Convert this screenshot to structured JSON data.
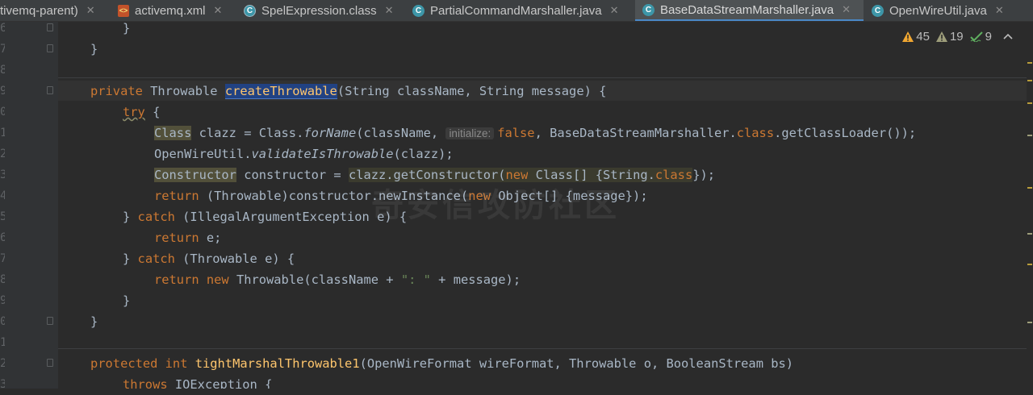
{
  "tabs": [
    {
      "label": "tivemq-parent)",
      "icon": "none",
      "active": false
    },
    {
      "label": "activemq.xml",
      "icon": "xml-file-icon",
      "active": false
    },
    {
      "label": "SpelExpression.class",
      "icon": "class-file-icon",
      "active": false
    },
    {
      "label": "PartialCommandMarshaller.java",
      "icon": "java-class-icon",
      "active": false
    },
    {
      "label": "BaseDataStreamMarshaller.java",
      "icon": "java-class-icon",
      "active": true
    },
    {
      "label": "OpenWireUtil.java",
      "icon": "java-class-icon",
      "active": false
    }
  ],
  "inspections": {
    "warnings": "45",
    "weak_warnings": "19",
    "typos": "9"
  },
  "line_numbers": [
    "6",
    "7",
    "8",
    "9",
    "0",
    "1",
    "2",
    "3",
    "4",
    "5",
    "6",
    "7",
    "8",
    "9",
    "0",
    "1",
    "2",
    "3"
  ],
  "code": {
    "l0": "}",
    "l1": "}",
    "l3": {
      "kw": "private ",
      "t1": "Throwable ",
      "name": "createThrowable",
      "rest": "(String className, String message) {"
    },
    "l4": {
      "kw": "try",
      "rest": " {"
    },
    "l5": {
      "cls": "Class",
      "a": " clazz = Class.",
      "m": "forName",
      "b": "(className,",
      "hint": "initialize:",
      "kw": "false",
      "c": ", BaseDataStreamMarshaller.",
      "kw2": "class",
      "d": ".getClassLoader());"
    },
    "l6": {
      "a": "OpenWireUtil.",
      "m": "validateIsThrowable",
      "b": "(clazz);"
    },
    "l7": {
      "cls": "Constructor",
      "a": " constructor = ",
      "b": "clazz.getConstructor(",
      "kw": "new",
      "c": " Class[] {String.",
      "kw2": "class",
      "d": "});"
    },
    "l8": {
      "kw": "return",
      "a": " (Throwable)constructor.newInstance(",
      "kw2": "new",
      "b": " Object[] {message});"
    },
    "l9": {
      "a": "} ",
      "kw": "catch",
      "b": " (IllegalArgumentException e) {"
    },
    "l10": {
      "kw": "return",
      "b": " e;"
    },
    "l11": {
      "a": "} ",
      "kw": "catch",
      "b": " (Throwable e) {"
    },
    "l12": {
      "kw": "return",
      "kw2": " new",
      "a": " Throwable(className + ",
      "s": "\": \"",
      "b": " + message);"
    },
    "l13": "}",
    "l14": "}",
    "l16": {
      "kw": "protected int ",
      "name": "tightMarshalThrowable1",
      "rest": "(OpenWireFormat wireFormat, Throwable o, BooleanStream bs)"
    },
    "l17": {
      "kw": "throws",
      "rest": " IOException {"
    }
  },
  "watermark": "奇安信攻防社区",
  "colors": {
    "background": "#2b2b2b",
    "keyword": "#cc7832",
    "method": "#ffc66d",
    "string": "#6a8759",
    "text": "#a9b7c6",
    "active_tab_underline": "#4a88c7"
  }
}
